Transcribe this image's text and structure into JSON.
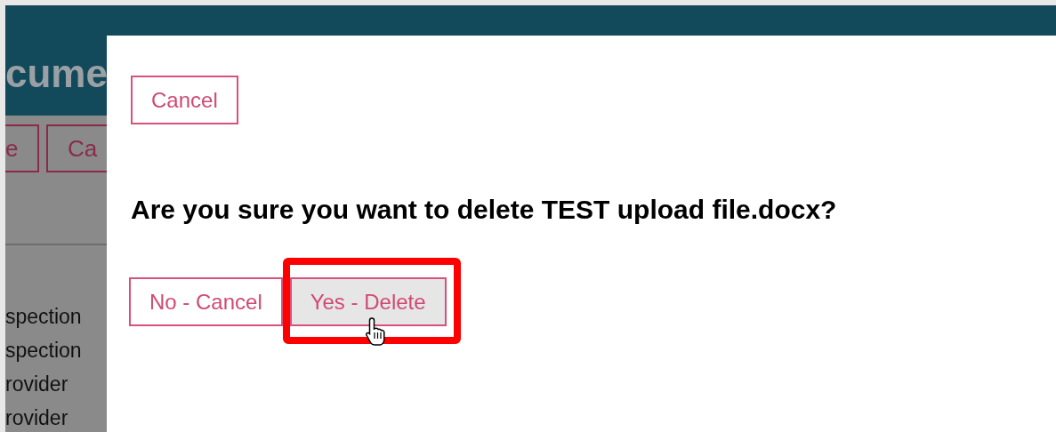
{
  "background_page": {
    "title": "cume",
    "buttons": [
      "e",
      "Ca"
    ],
    "rows": [
      "spection",
      "spection",
      "rovider",
      "rovider"
    ]
  },
  "dialog": {
    "close_button": "Cancel",
    "question": "Are you sure you want to delete TEST upload file.docx?",
    "actions": [
      {
        "label": "No - Cancel",
        "hovered": false,
        "highlighted": false
      },
      {
        "label": "Yes - Delete",
        "hovered": true,
        "highlighted": true
      }
    ]
  }
}
